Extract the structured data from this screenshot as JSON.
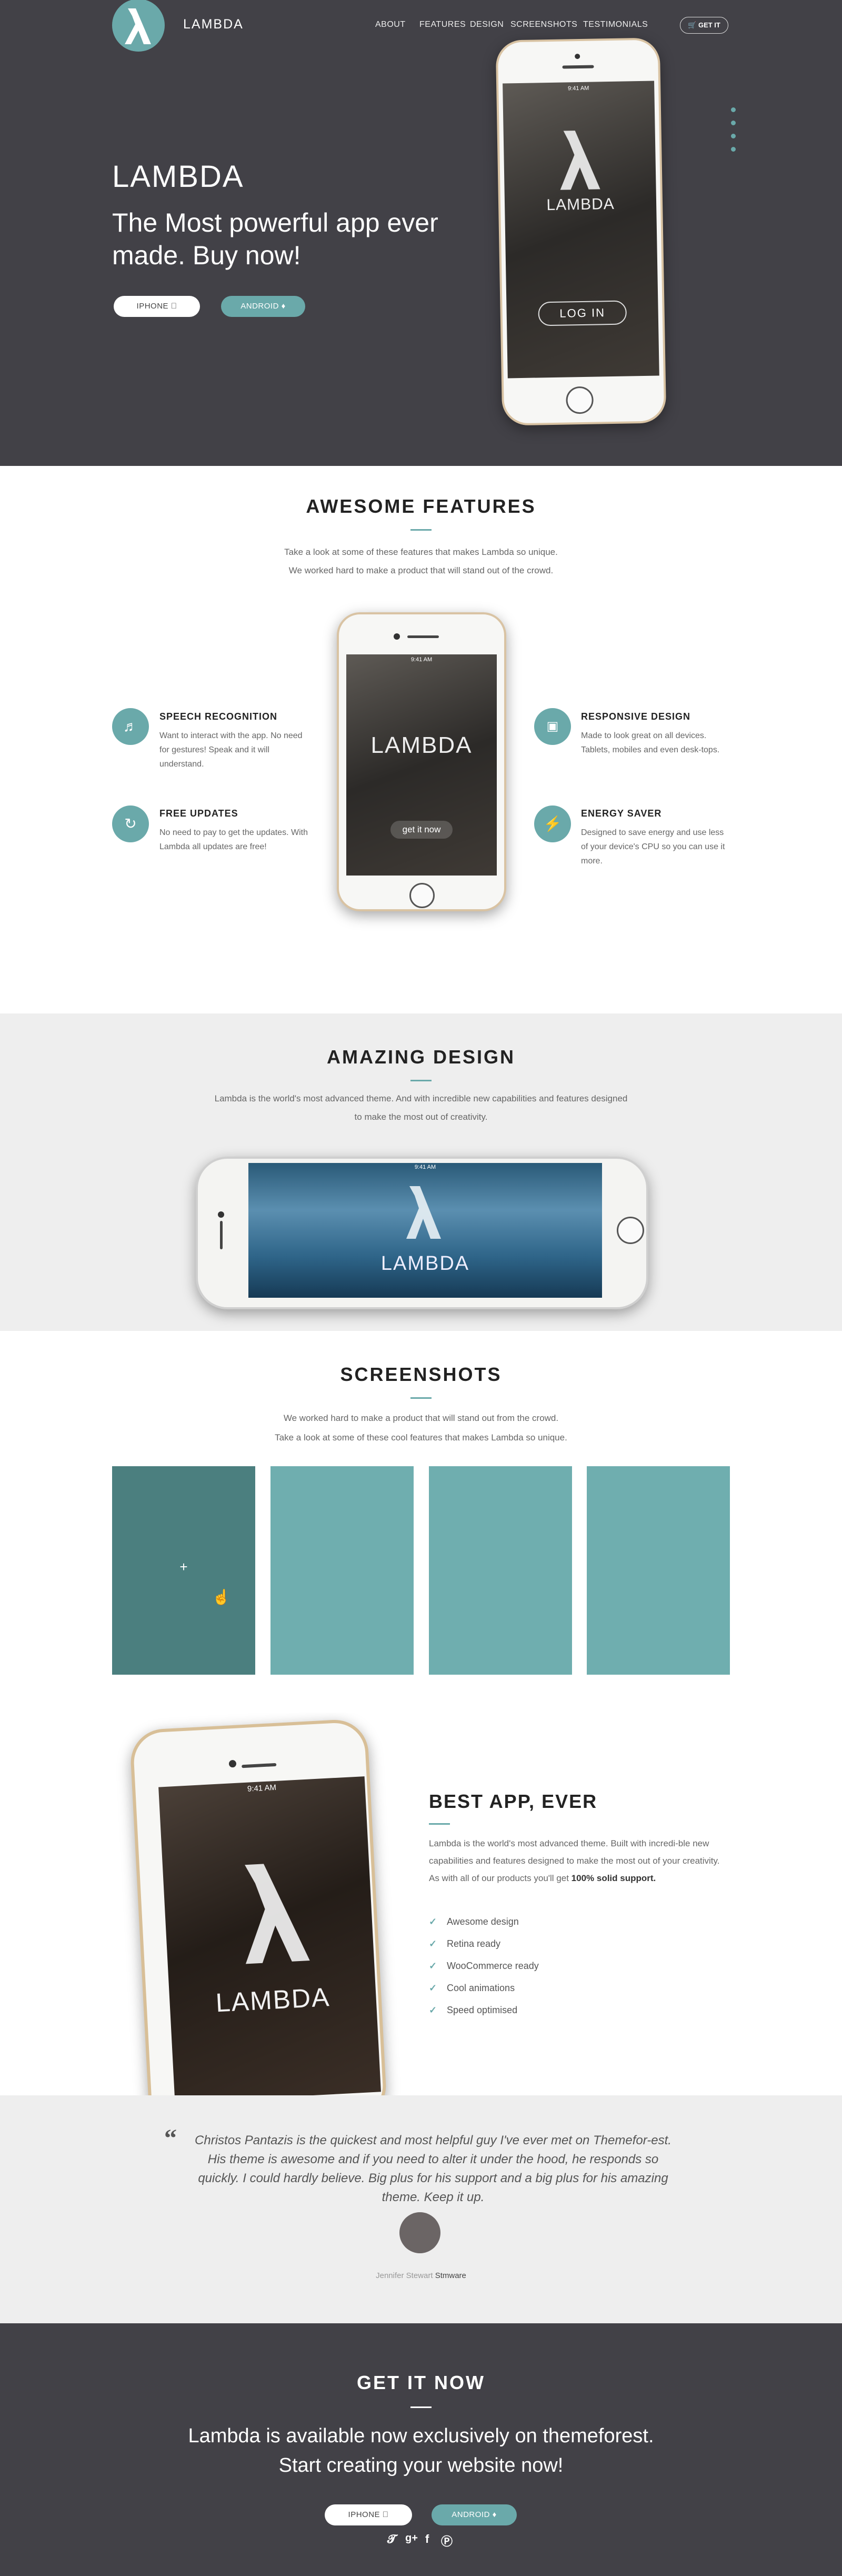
{
  "header": {
    "brand": "LAMBDA",
    "nav": [
      "ABOUT",
      "FEATURES",
      "DESIGN",
      "SCREENSHOTS",
      "TESTIMONIALS"
    ],
    "get_it": "🛒 GET IT"
  },
  "hero": {
    "title": "LAMBDA",
    "subtitle": "The Most powerful app ever made. Buy now!",
    "iphone_btn": "IPHONE ",
    "android_btn": "ANDROID ♦",
    "phone_time": "9:41 AM",
    "phone_brand": "LAMBDA",
    "phone_login": "LOG IN"
  },
  "features": {
    "title": "AWESOME FEATURES",
    "lead1": "Take a look at some of these features that makes Lambda so unique.",
    "lead2": "We worked hard to make a product that will stand out of the crowd.",
    "phone_time": "9:41 AM",
    "phone_brand": "LAMBDA",
    "phone_cta": "get it now",
    "items": [
      {
        "title": "SPEECH RECOGNITION",
        "text": "Want to interact with the app. No need for gestures! Speak and it will understand.",
        "icon": "volume-icon"
      },
      {
        "title": "FREE UPDATES",
        "text": "No need to pay to get the updates. With Lambda all updates are free!",
        "icon": "refresh-icon"
      },
      {
        "title": "RESPONSIVE DESIGN",
        "text": "Made to look great on all devices. Tablets, mobiles and even desk-tops.",
        "icon": "monitor-icon"
      },
      {
        "title": "ENERGY SAVER",
        "text": "Designed to save energy and use less of your device's CPU so you can use it more.",
        "icon": "bolt-icon"
      }
    ]
  },
  "design": {
    "title": "AMAZING DESIGN",
    "lead": "Lambda is the world's most advanced theme. And with incredible new capabilities and features designed to make the most out of creativity.",
    "phone_time": "9:41 AM",
    "phone_brand": "LAMBDA"
  },
  "screenshots": {
    "title": "SCREENSHOTS",
    "lead1": "We worked hard to make a product that will stand out from the crowd.",
    "lead2": "Take a look at some of these cool features that makes Lambda so unique.",
    "plus": "+"
  },
  "bestapp": {
    "title": "BEST APP, EVER",
    "text": "Lambda is the world's most advanced theme. Built with incredi-ble new capabilities and features designed to make the most out of your creativity. As with all of our products you'll get",
    "strong": "100% solid support.",
    "phone_time": "9:41 AM",
    "phone_brand": "LAMBDA",
    "list": [
      "Awesome design",
      "Retina ready",
      "WooCommerce ready",
      "Cool animations",
      "Speed optimised"
    ]
  },
  "testimonial": {
    "quote": "Christos Pantazis is the quickest and most helpful guy I've ever met on Themefor-est. His theme is awesome and if you need to alter it under the hood, he responds so quickly. I could hardly believe. Big plus for his support and a big plus for his amazing theme. Keep it up.",
    "author": "Jennifer Stewart",
    "company": "Stmware"
  },
  "cta": {
    "title": "GET IT NOW",
    "line1": "Lambda is available now exclusively on themeforest.",
    "line2": "Start creating your website now!",
    "iphone_btn": "IPHONE ",
    "android_btn": "ANDROID ♦"
  },
  "colors": {
    "accent": "#6aa9aa",
    "dark_bg": "#424147",
    "light_bg": "#eeeeee"
  }
}
